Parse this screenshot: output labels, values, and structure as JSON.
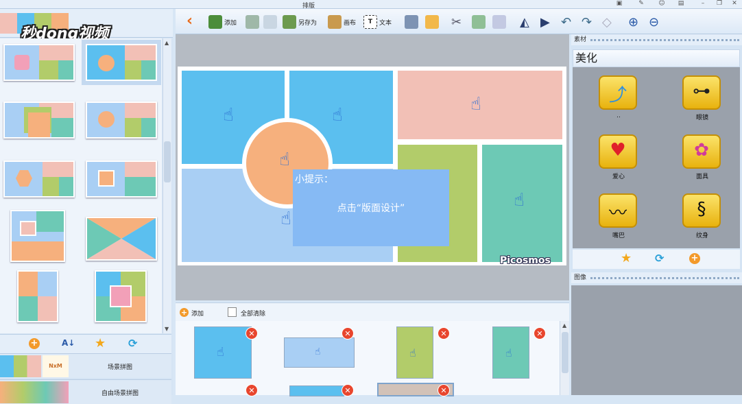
{
  "window": {
    "title": "排版"
  },
  "logo": {
    "text": "秒dong视频"
  },
  "toolbar": {
    "add": "添加",
    "saveas": "另存为",
    "canvas": "画布",
    "text": "文本"
  },
  "hint": {
    "title": "小提示：",
    "body": "点击“版面设计”"
  },
  "brand": "Picosmos",
  "photobar": {
    "add": "添加",
    "clear_all": "全部清除"
  },
  "left": {
    "scenes": [
      {
        "label": "场景拼图",
        "thumb_text": "NxM"
      },
      {
        "label": "自由场景拼图"
      }
    ]
  },
  "right": {
    "materials_header": "素材",
    "beauty": "美化",
    "images_header": "图像",
    "materials": [
      {
        "label": "..",
        "icon": "up-arrow"
      },
      {
        "label": "眼镜",
        "icon": "glasses"
      },
      {
        "label": "爱心",
        "icon": "heart"
      },
      {
        "label": "面具",
        "icon": "mask"
      },
      {
        "label": "嘴巴",
        "icon": "mustache"
      },
      {
        "label": "纹身",
        "icon": "dragon"
      }
    ]
  },
  "colors": {
    "blue": "#5bbfef",
    "lightblue": "#a9cff4",
    "pink": "#f2c0b6",
    "orange": "#f6b07d",
    "green": "#b2cc6a",
    "teal": "#6dc9b5",
    "hint": "#86baf4"
  }
}
